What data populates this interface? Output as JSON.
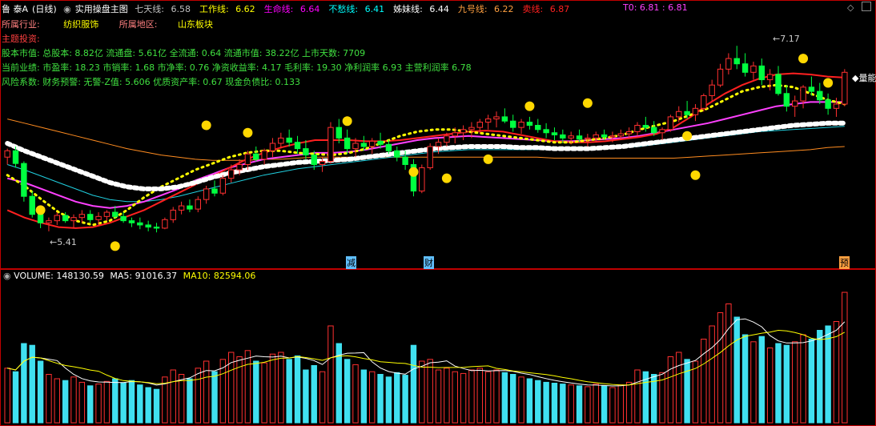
{
  "header": {
    "stock_name": "鲁 泰A",
    "period": "(日线)",
    "indicator_name": "实用操盘主图",
    "ma_items": [
      {
        "label": "七天线:",
        "value": "6.58",
        "color": "#c0c0c0"
      },
      {
        "label": "工作线:",
        "value": "6.62",
        "color": "#ffff00"
      },
      {
        "label": "生命线:",
        "value": "6.64",
        "color": "#ff00ff"
      },
      {
        "label": "不愁线:",
        "value": "6.41",
        "color": "#00ffff"
      },
      {
        "label": "姊妹线:",
        "value": "6.44",
        "color": "#ffffff"
      },
      {
        "label": "九号线:",
        "value": "6.22",
        "color": "#ffa040"
      },
      {
        "label": "卖线:",
        "value": "6.87",
        "color": "#ff2020"
      }
    ],
    "t0": "T0: 6.81 : 6.81"
  },
  "info": {
    "industry_label": "所属行业:",
    "industry_value": "纺织服饰",
    "region_label": "所属地区:",
    "region_value": "山东板块",
    "theme_label": "主题投资:",
    "line1": "股本市值: 总股本: 8.82亿 流通盘: 5.61亿 全流通: 0.64 流通市值: 38.22亿 上市天数: 7709",
    "line2": "当前业绩: 市盈率: 18.23 市销率: 1.68 市净率: 0.76 净资收益率: 4.17 毛利率: 19.30 净利润率 6.93 主营利润率 6.78",
    "line3": "风险系数: 财务预警: 无警-Z值: 5.606 优质资产率: 0.67 现金负债比: 0.133"
  },
  "markers": {
    "high_label": "7.17",
    "low_label": "5.41",
    "right_label": "量能",
    "mark_jian": "减",
    "mark_cai": "财",
    "mark_yu": "预"
  },
  "volume_header": {
    "title": "VOLUME:",
    "volume": "148130.59",
    "ma5_label": "MA5:",
    "ma5": "91016.37",
    "ma10_label": "MA10:",
    "ma10": "82594.06"
  },
  "colors": {
    "up": "#ff3030",
    "down": "#00ff40",
    "vol_up": "#ff3030",
    "vol_down": "#40e0f0",
    "border": "#c00000"
  },
  "chart_data": {
    "type": "candlestick",
    "ylim": [
      5.2,
      7.3
    ],
    "volume_ylim": [
      0,
      160000
    ],
    "candles": [
      [
        6.12,
        6.2,
        6.05,
        6.18,
        62000
      ],
      [
        6.18,
        6.22,
        6.02,
        6.06,
        58000
      ],
      [
        6.06,
        6.08,
        5.7,
        5.75,
        90000
      ],
      [
        5.75,
        5.8,
        5.55,
        5.58,
        88000
      ],
      [
        5.58,
        5.62,
        5.45,
        5.5,
        70000
      ],
      [
        5.5,
        5.55,
        5.42,
        5.52,
        55000
      ],
      [
        5.52,
        5.6,
        5.48,
        5.57,
        50000
      ],
      [
        5.57,
        5.6,
        5.5,
        5.52,
        48000
      ],
      [
        5.52,
        5.58,
        5.45,
        5.55,
        52000
      ],
      [
        5.55,
        5.62,
        5.5,
        5.58,
        46000
      ],
      [
        5.58,
        5.62,
        5.5,
        5.53,
        42000
      ],
      [
        5.53,
        5.6,
        5.48,
        5.56,
        44000
      ],
      [
        5.56,
        5.62,
        5.52,
        5.6,
        47000
      ],
      [
        5.6,
        5.66,
        5.54,
        5.56,
        50000
      ],
      [
        5.56,
        5.6,
        5.5,
        5.52,
        45000
      ],
      [
        5.52,
        5.55,
        5.46,
        5.5,
        48000
      ],
      [
        5.5,
        5.55,
        5.44,
        5.48,
        43000
      ],
      [
        5.48,
        5.52,
        5.42,
        5.46,
        40000
      ],
      [
        5.46,
        5.5,
        5.41,
        5.45,
        38000
      ],
      [
        5.45,
        5.55,
        5.44,
        5.53,
        52000
      ],
      [
        5.53,
        5.65,
        5.5,
        5.62,
        60000
      ],
      [
        5.62,
        5.7,
        5.58,
        5.66,
        55000
      ],
      [
        5.66,
        5.72,
        5.6,
        5.63,
        50000
      ],
      [
        5.63,
        5.75,
        5.6,
        5.72,
        62000
      ],
      [
        5.72,
        5.85,
        5.68,
        5.82,
        70000
      ],
      [
        5.82,
        5.9,
        5.75,
        5.78,
        58000
      ],
      [
        5.78,
        5.95,
        5.76,
        5.92,
        72000
      ],
      [
        5.92,
        6.05,
        5.88,
        6.0,
        80000
      ],
      [
        6.0,
        6.1,
        5.95,
        6.05,
        75000
      ],
      [
        6.05,
        6.18,
        6.0,
        6.15,
        82000
      ],
      [
        6.15,
        6.22,
        6.08,
        6.1,
        70000
      ],
      [
        6.1,
        6.2,
        6.05,
        6.18,
        68000
      ],
      [
        6.18,
        6.3,
        6.12,
        6.25,
        78000
      ],
      [
        6.25,
        6.35,
        6.2,
        6.3,
        80000
      ],
      [
        6.3,
        6.38,
        6.22,
        6.26,
        72000
      ],
      [
        6.26,
        6.32,
        6.15,
        6.2,
        76000
      ],
      [
        6.2,
        6.28,
        6.1,
        6.14,
        60000
      ],
      [
        6.14,
        6.18,
        6.0,
        6.05,
        65000
      ],
      [
        6.05,
        6.12,
        5.98,
        6.08,
        58000
      ],
      [
        6.08,
        6.45,
        6.06,
        6.4,
        110000
      ],
      [
        6.4,
        6.48,
        6.25,
        6.3,
        90000
      ],
      [
        6.3,
        6.38,
        6.15,
        6.2,
        72000
      ],
      [
        6.2,
        6.3,
        6.12,
        6.25,
        66000
      ],
      [
        6.25,
        6.32,
        6.18,
        6.22,
        60000
      ],
      [
        6.22,
        6.3,
        6.15,
        6.27,
        58000
      ],
      [
        6.27,
        6.35,
        6.2,
        6.24,
        55000
      ],
      [
        6.24,
        6.28,
        6.15,
        6.18,
        52000
      ],
      [
        6.18,
        6.22,
        6.08,
        6.12,
        57000
      ],
      [
        6.12,
        6.18,
        6.0,
        6.05,
        54000
      ],
      [
        6.05,
        6.1,
        5.75,
        5.8,
        88000
      ],
      [
        5.8,
        6.05,
        5.78,
        6.02,
        70000
      ],
      [
        6.02,
        6.25,
        6.0,
        6.22,
        72000
      ],
      [
        6.22,
        6.3,
        6.15,
        6.26,
        60000
      ],
      [
        6.26,
        6.35,
        6.22,
        6.32,
        62000
      ],
      [
        6.32,
        6.4,
        6.25,
        6.35,
        58000
      ],
      [
        6.35,
        6.42,
        6.28,
        6.38,
        56000
      ],
      [
        6.38,
        6.45,
        6.3,
        6.4,
        60000
      ],
      [
        6.4,
        6.48,
        6.34,
        6.45,
        62000
      ],
      [
        6.45,
        6.52,
        6.38,
        6.48,
        58000
      ],
      [
        6.48,
        6.55,
        6.4,
        6.5,
        60000
      ],
      [
        6.5,
        6.58,
        6.44,
        6.46,
        57000
      ],
      [
        6.46,
        6.52,
        6.36,
        6.4,
        55000
      ],
      [
        6.4,
        6.48,
        6.34,
        6.45,
        52000
      ],
      [
        6.45,
        6.5,
        6.38,
        6.42,
        50000
      ],
      [
        6.42,
        6.48,
        6.35,
        6.38,
        48000
      ],
      [
        6.38,
        6.44,
        6.3,
        6.35,
        46000
      ],
      [
        6.35,
        6.4,
        6.28,
        6.33,
        45000
      ],
      [
        6.33,
        6.38,
        6.25,
        6.3,
        44000
      ],
      [
        6.3,
        6.36,
        6.24,
        6.32,
        43000
      ],
      [
        6.32,
        6.38,
        6.26,
        6.29,
        42000
      ],
      [
        6.29,
        6.34,
        6.22,
        6.3,
        41000
      ],
      [
        6.3,
        6.36,
        6.26,
        6.33,
        44000
      ],
      [
        6.33,
        6.38,
        6.28,
        6.31,
        42000
      ],
      [
        6.31,
        6.36,
        6.26,
        6.32,
        40000
      ],
      [
        6.32,
        6.38,
        6.28,
        6.34,
        43000
      ],
      [
        6.34,
        6.4,
        6.3,
        6.36,
        46000
      ],
      [
        6.36,
        6.45,
        6.32,
        6.42,
        60000
      ],
      [
        6.42,
        6.5,
        6.36,
        6.4,
        58000
      ],
      [
        6.4,
        6.46,
        6.32,
        6.35,
        55000
      ],
      [
        6.35,
        6.4,
        6.28,
        6.38,
        57000
      ],
      [
        6.38,
        6.52,
        6.36,
        6.5,
        75000
      ],
      [
        6.5,
        6.6,
        6.45,
        6.55,
        80000
      ],
      [
        6.55,
        6.65,
        6.48,
        6.52,
        72000
      ],
      [
        6.52,
        6.62,
        6.46,
        6.58,
        70000
      ],
      [
        6.58,
        6.72,
        6.55,
        6.7,
        95000
      ],
      [
        6.7,
        6.85,
        6.65,
        6.8,
        110000
      ],
      [
        6.8,
        7.0,
        6.78,
        6.95,
        125000
      ],
      [
        6.95,
        7.1,
        6.9,
        7.05,
        135000
      ],
      [
        7.05,
        7.17,
        6.95,
        7.0,
        120000
      ],
      [
        7.0,
        7.1,
        6.88,
        6.92,
        100000
      ],
      [
        6.92,
        7.02,
        6.85,
        6.98,
        92000
      ],
      [
        6.98,
        7.05,
        6.8,
        6.85,
        98000
      ],
      [
        6.85,
        6.95,
        6.75,
        6.9,
        85000
      ],
      [
        6.9,
        6.98,
        6.7,
        6.72,
        90000
      ],
      [
        6.72,
        6.8,
        6.55,
        6.6,
        88000
      ],
      [
        6.6,
        6.7,
        6.5,
        6.65,
        92000
      ],
      [
        6.65,
        6.8,
        6.58,
        6.78,
        100000
      ],
      [
        6.78,
        6.88,
        6.7,
        6.74,
        95000
      ],
      [
        6.74,
        6.82,
        6.62,
        6.66,
        105000
      ],
      [
        6.66,
        6.72,
        6.52,
        6.58,
        110000
      ],
      [
        6.58,
        6.68,
        6.5,
        6.62,
        115000
      ],
      [
        6.62,
        6.95,
        6.6,
        6.92,
        148130
      ]
    ],
    "lines": {
      "sell_line": [
        5.62,
        5.55,
        5.5,
        5.46,
        5.45,
        5.46,
        5.5,
        5.56,
        5.62,
        5.7,
        5.78,
        5.86,
        5.94,
        6.02,
        6.1,
        6.16,
        6.21,
        6.25,
        6.28,
        6.28,
        6.28,
        6.27,
        6.27,
        6.28,
        6.3,
        6.32,
        6.34,
        6.36,
        6.37,
        6.36,
        6.33,
        6.3,
        6.27,
        6.26,
        6.26,
        6.27,
        6.29,
        6.31,
        6.34,
        6.4,
        6.5,
        6.62,
        6.72,
        6.8,
        6.86,
        6.9,
        6.91,
        6.9,
        6.88,
        6.87
      ],
      "work_line": [
        5.95,
        5.85,
        5.72,
        5.6,
        5.52,
        5.48,
        5.52,
        5.62,
        5.74,
        5.84,
        5.92,
        6.0,
        6.06,
        6.12,
        6.16,
        6.18,
        6.18,
        6.16,
        6.15,
        6.14,
        6.16,
        6.2,
        6.26,
        6.32,
        6.36,
        6.38,
        6.38,
        6.36,
        6.34,
        6.32,
        6.3,
        6.28,
        6.26,
        6.26,
        6.28,
        6.3,
        6.33,
        6.38,
        6.42,
        6.46,
        6.52,
        6.58,
        6.66,
        6.74,
        6.78,
        6.8,
        6.78,
        6.72,
        6.66,
        6.62
      ],
      "life_line": [
        5.92,
        5.88,
        5.82,
        5.76,
        5.7,
        5.66,
        5.64,
        5.66,
        5.7,
        5.76,
        5.82,
        5.9,
        5.96,
        6.02,
        6.06,
        6.1,
        6.12,
        6.14,
        6.16,
        6.16,
        6.17,
        6.19,
        6.22,
        6.25,
        6.28,
        6.3,
        6.31,
        6.32,
        6.31,
        6.3,
        6.29,
        6.28,
        6.27,
        6.27,
        6.28,
        6.29,
        6.3,
        6.32,
        6.35,
        6.38,
        6.41,
        6.44,
        6.48,
        6.52,
        6.56,
        6.6,
        6.62,
        6.64,
        6.64,
        6.64
      ],
      "sister_line": [
        6.25,
        6.18,
        6.12,
        6.06,
        6.0,
        5.94,
        5.88,
        5.84,
        5.82,
        5.82,
        5.84,
        5.88,
        5.93,
        5.97,
        6.0,
        6.03,
        6.05,
        6.07,
        6.08,
        6.09,
        6.1,
        6.12,
        6.14,
        6.16,
        6.18,
        6.2,
        6.21,
        6.22,
        6.22,
        6.22,
        6.21,
        6.21,
        6.2,
        6.2,
        6.2,
        6.21,
        6.22,
        6.24,
        6.26,
        6.28,
        6.3,
        6.32,
        6.34,
        6.36,
        6.38,
        6.4,
        6.42,
        6.43,
        6.44,
        6.44
      ],
      "worry_line": [
        6.05,
        6.0,
        5.94,
        5.88,
        5.82,
        5.76,
        5.72,
        5.7,
        5.7,
        5.72,
        5.75,
        5.79,
        5.83,
        5.87,
        5.91,
        5.95,
        5.98,
        6.01,
        6.03,
        6.05,
        6.07,
        6.09,
        6.11,
        6.13,
        6.15,
        6.17,
        6.18,
        6.19,
        6.19,
        6.19,
        6.19,
        6.19,
        6.19,
        6.19,
        6.19,
        6.2,
        6.21,
        6.22,
        6.24,
        6.26,
        6.28,
        6.3,
        6.32,
        6.34,
        6.36,
        6.37,
        6.38,
        6.39,
        6.4,
        6.41
      ],
      "nine_line": [
        6.48,
        6.44,
        6.4,
        6.36,
        6.32,
        6.28,
        6.24,
        6.2,
        6.17,
        6.14,
        6.12,
        6.1,
        6.09,
        6.09,
        6.09,
        6.1,
        6.1,
        6.11,
        6.12,
        6.12,
        6.12,
        6.12,
        6.12,
        6.12,
        6.12,
        6.12,
        6.12,
        6.12,
        6.12,
        6.12,
        6.12,
        6.12,
        6.11,
        6.11,
        6.11,
        6.11,
        6.11,
        6.11,
        6.11,
        6.11,
        6.12,
        6.13,
        6.14,
        6.15,
        6.16,
        6.17,
        6.18,
        6.19,
        6.21,
        6.22
      ]
    }
  }
}
